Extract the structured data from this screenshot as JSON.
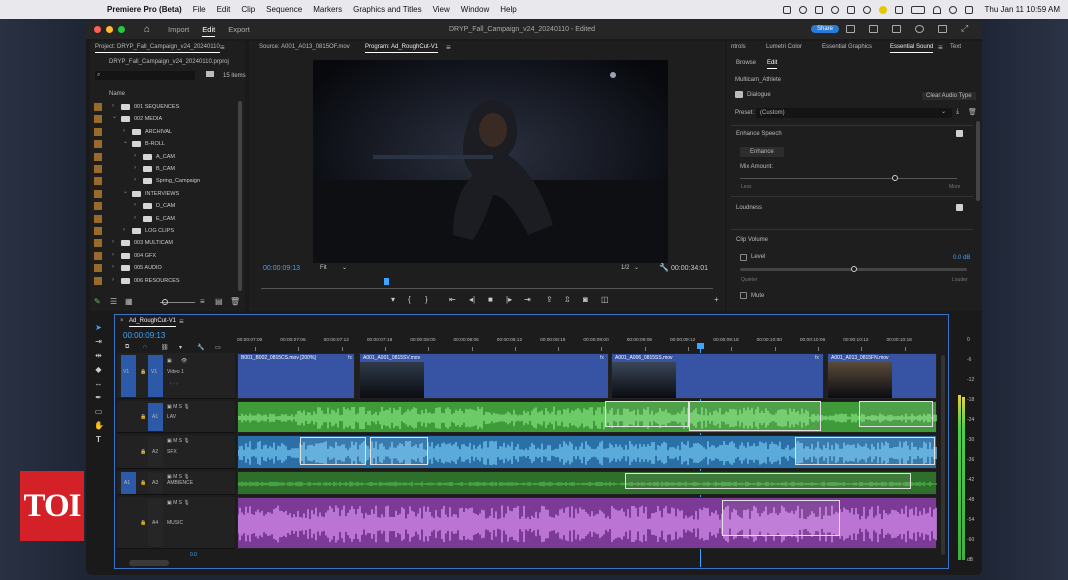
{
  "menubar": {
    "app": "Premiere Pro (Beta)",
    "items": [
      "File",
      "Edit",
      "Clip",
      "Sequence",
      "Markers",
      "Graphics and Titles",
      "View",
      "Window",
      "Help"
    ],
    "clock": "Thu Jan 11  10:59 AM"
  },
  "window": {
    "tabs": [
      "Import",
      "Edit",
      "Export"
    ],
    "active_tab": "Edit",
    "title": "DRYP_Fall_Campaign_v24_20240110 - Edited",
    "share": "Share"
  },
  "project": {
    "title": "Project: DRYP_Fall_Campaign_v24_20240110",
    "file": "DRYP_Fall_Campaign_v24_20240110.prproj",
    "count": "15 items",
    "col": "Name",
    "rows": [
      {
        "l": "001 SEQUENCES",
        "d": 0
      },
      {
        "l": "002 MEDIA",
        "d": 0,
        "o": true
      },
      {
        "l": "ARCHIVAL",
        "d": 1
      },
      {
        "l": "B-ROLL",
        "d": 1,
        "o": true
      },
      {
        "l": "A_CAM",
        "d": 2
      },
      {
        "l": "B_CAM",
        "d": 2
      },
      {
        "l": "Spring_Campaign",
        "d": 2
      },
      {
        "l": "INTERVIEWS",
        "d": 1,
        "o": true
      },
      {
        "l": "D_CAM",
        "d": 2
      },
      {
        "l": "E_CAM",
        "d": 2
      },
      {
        "l": "LOG CLIPS",
        "d": 1
      },
      {
        "l": "003 MULTICAM",
        "d": 0
      },
      {
        "l": "004 GFX",
        "d": 0
      },
      {
        "l": "005 AUDIO",
        "d": 0
      },
      {
        "l": "006 RESOURCES",
        "d": 0
      }
    ]
  },
  "monitor": {
    "source_tab": "Source: A001_A013_0815OF.mov",
    "program_tab": "Program: Ad_RoughCut-V1",
    "timecode": "00:00:09:13",
    "fit": "Fit",
    "res": "1/2",
    "duration": "00:00:34:01"
  },
  "right": {
    "tabs": [
      "ntrols",
      "Lumetri Color",
      "Essential Graphics",
      "Essential Sound",
      "Text"
    ],
    "active": "Essential Sound",
    "sub": [
      "Browse",
      "Edit"
    ],
    "clip": "Multicam_Athlete",
    "type": "Dialogue",
    "clear": "Clear Audio Type",
    "preset_label": "Preset:",
    "preset": "(Custom)",
    "enhance": "Enhance Speech",
    "enhance_btn": "Enhance",
    "mix": "Mix Amount:",
    "mix_lo": "Less",
    "mix_hi": "More",
    "loud": "Loudness",
    "clipvol": "Clip Volume",
    "level": "Level",
    "level_val": "0.0 dB",
    "quieter": "Quieter",
    "louder": "Louder",
    "mute": "Mute"
  },
  "timeline": {
    "tab": "Ad_RoughCut-V1",
    "tc": "00:00:09:13",
    "ruler": [
      "00:00:07:00",
      "00:00:07:06",
      "00:00:07:12",
      "00:00:07:18",
      "00:00:08:00",
      "00:00:08:06",
      "00:00:08:12",
      "00:00:08:18",
      "00:00:09:00",
      "00:00:09:06",
      "00:00:09:12",
      "00:00:09:18",
      "00:00:10:00",
      "00:00:10:06",
      "00:00:10:12",
      "00:00:10:18"
    ],
    "v1": "Video 1",
    "a1": "LAV",
    "a2": "SFX",
    "a3": "AMBIENCE",
    "a4": "MUSIC",
    "mix": "0.0",
    "clips": [
      "B001_B002_0815CS.mov [200%]",
      "A001_A001_0815SV.mov",
      "A001_A006_0815SS.mov",
      "A001_A013_0815FN.mov"
    ]
  },
  "meter": [
    "0",
    "-6",
    "-12",
    "-18",
    "-24",
    "-30",
    "-36",
    "-42",
    "-48",
    "-54",
    "-60",
    "dB"
  ],
  "watermark": "TOI",
  "colors": {
    "accent": "#3ea5ff",
    "video_clip": "#3654a3",
    "lav": "#3f9a3a",
    "sfx": "#2f7fbf",
    "amb": "#3a8a35",
    "music": "#9a4ab0"
  }
}
